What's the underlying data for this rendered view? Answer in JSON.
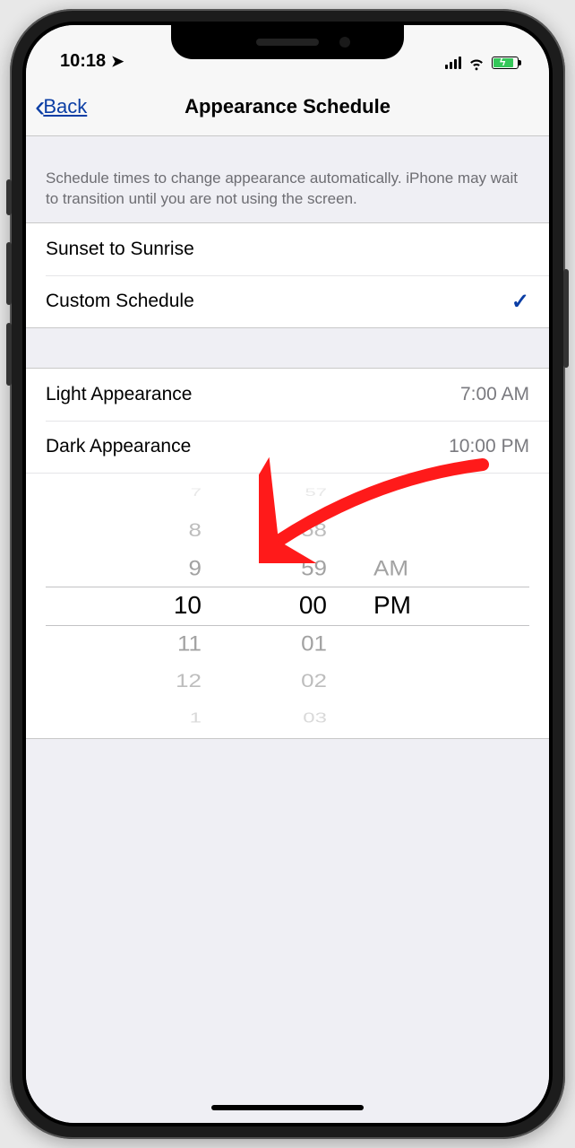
{
  "status": {
    "time": "10:18"
  },
  "nav": {
    "back": "Back",
    "title": "Appearance Schedule"
  },
  "desc": "Schedule times to change appearance automatically. iPhone may wait to transition until you are not using the screen.",
  "options": {
    "sunset": "Sunset to Sunrise",
    "custom": "Custom Schedule"
  },
  "appearance": {
    "light_label": "Light Appearance",
    "light_time": "7:00 AM",
    "dark_label": "Dark Appearance",
    "dark_time": "10:00 PM"
  },
  "picker": {
    "hours": [
      "7",
      "8",
      "9",
      "10",
      "11",
      "12",
      "1"
    ],
    "minutes": [
      "57",
      "58",
      "59",
      "00",
      "01",
      "02",
      "03"
    ],
    "ampm": [
      "",
      "",
      "AM",
      "PM",
      "",
      "",
      ""
    ]
  }
}
